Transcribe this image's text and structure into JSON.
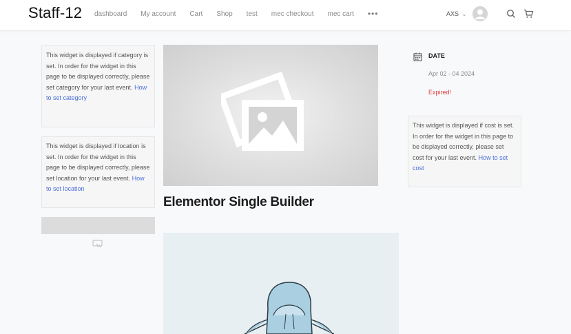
{
  "header": {
    "site_title": "Staff-12",
    "nav": [
      "dashboard",
      "My account",
      "Cart",
      "Shop",
      "test",
      "mec checkout",
      "mec cart"
    ],
    "more_label": "•••",
    "currency": "AXS"
  },
  "left_sidebar": {
    "category_notice": "This widget is displayed if category is set. In order for the widget in this page to be displayed correctly, please set category for your last event.",
    "category_link": "How to set category",
    "location_notice": "This widget is displayed if location is set. In order for the widget in this page to be displayed correctly, please set location for your last event.",
    "location_link": "How to set location"
  },
  "main": {
    "event_title": "Elementor Single Builder"
  },
  "right_sidebar": {
    "date_label": "DATE",
    "date_value": "Apr 02 - 04 2024",
    "status": "Expired!",
    "cost_notice": "This widget is displayed if cost is set. In order for the widget in this page to be displayed correctly, please set cost for your last event.",
    "cost_link": "How to set cost"
  },
  "colors": {
    "link": "#4a6fd9",
    "expired": "#e03c3c",
    "background": "#f8f9fb"
  }
}
